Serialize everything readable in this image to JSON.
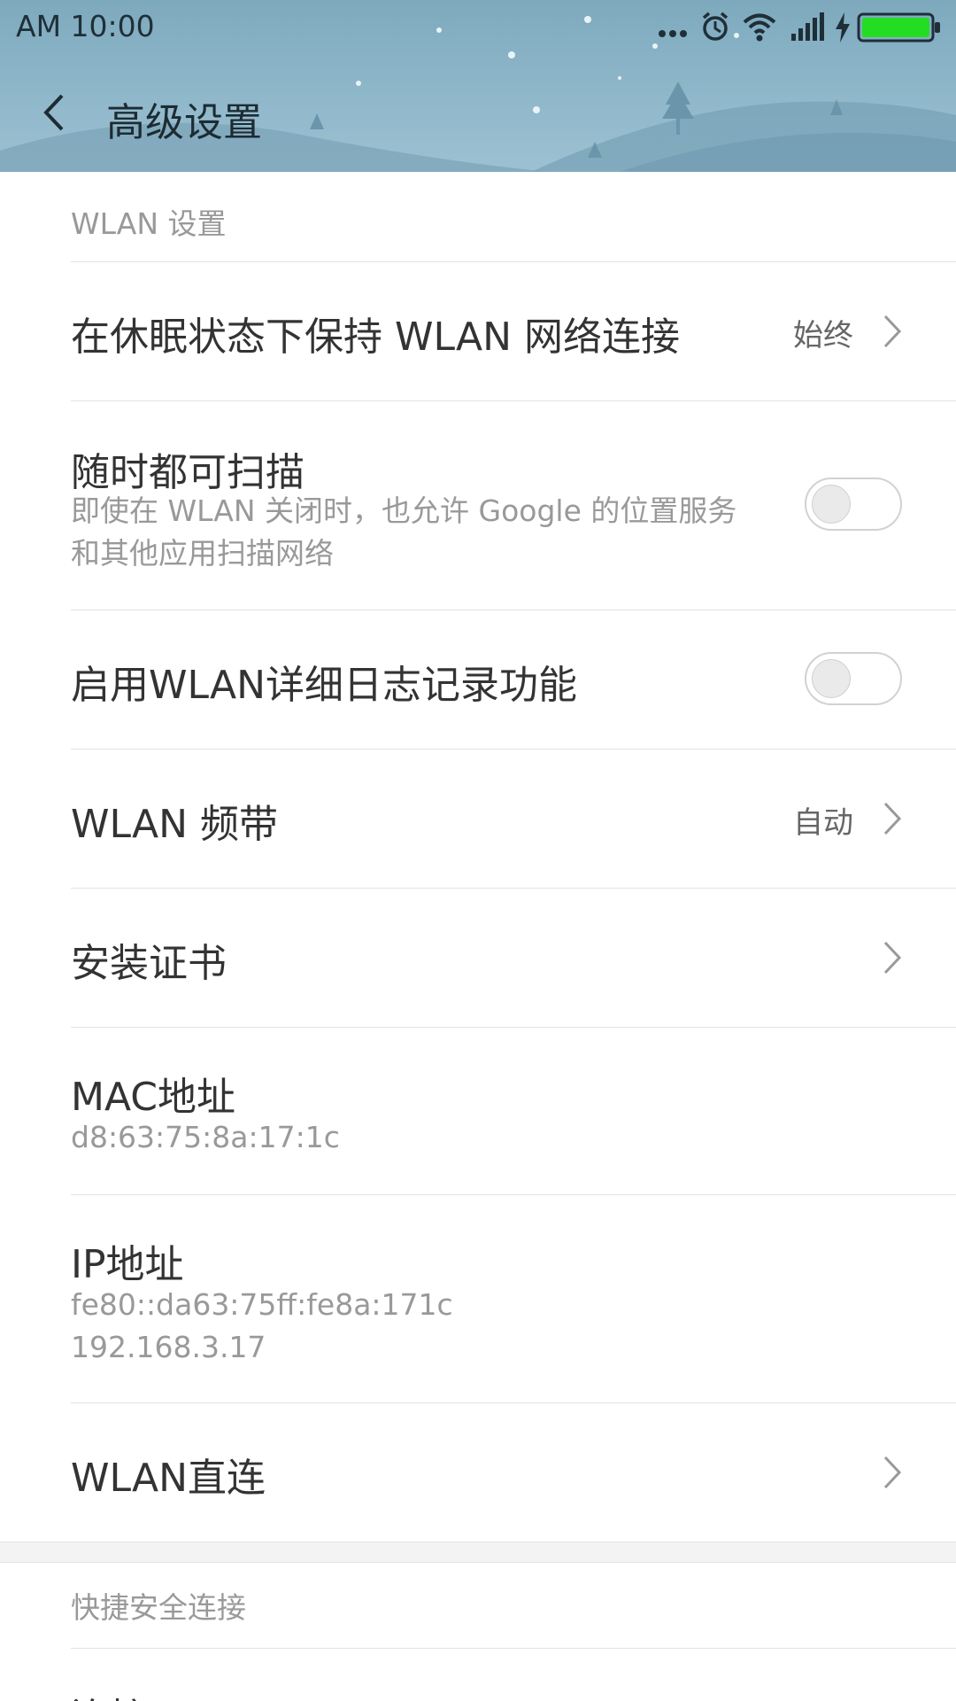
{
  "status_bar": {
    "time": "AM  10:00",
    "icons": [
      "more-dots-icon",
      "alarm-icon",
      "wifi-icon",
      "signal-icon",
      "charging-icon",
      "battery-icon"
    ],
    "battery_color": "#22dd22"
  },
  "title_bar": {
    "back_icon": "back-arrow-icon",
    "title": "高级设置"
  },
  "sections": {
    "wlan_settings": "WLAN 设置",
    "quick_connect": "快捷安全连接"
  },
  "items": {
    "keep_wlan": {
      "title": "在休眠状态下保持 WLAN 网络连接",
      "value": "始终"
    },
    "always_scan": {
      "title": "随时都可扫描",
      "subtitle": "即使在 WLAN 关闭时，也允许 Google 的位置服务和其他应用扫描网络",
      "enabled": false
    },
    "verbose_log": {
      "title": "启用WLAN详细日志记录功能",
      "enabled": false
    },
    "wlan_band": {
      "title": "WLAN 频带",
      "value": "自动"
    },
    "install_cert": {
      "title": "安装证书"
    },
    "mac": {
      "title": "MAC地址",
      "value": "d8:63:75:8a:17:1c"
    },
    "ip": {
      "title": "IP地址",
      "ipv6": "fe80::da63:75ff:fe8a:171c",
      "ipv4": "192.168.3.17"
    },
    "wlan_direct": {
      "title": "WLAN直连"
    },
    "wps": {
      "title": "连接WPS"
    }
  },
  "colors": {
    "header": "#8fb7ca",
    "primary_text": "#333333",
    "secondary_text": "#999999",
    "divider": "#e3e3e3"
  }
}
